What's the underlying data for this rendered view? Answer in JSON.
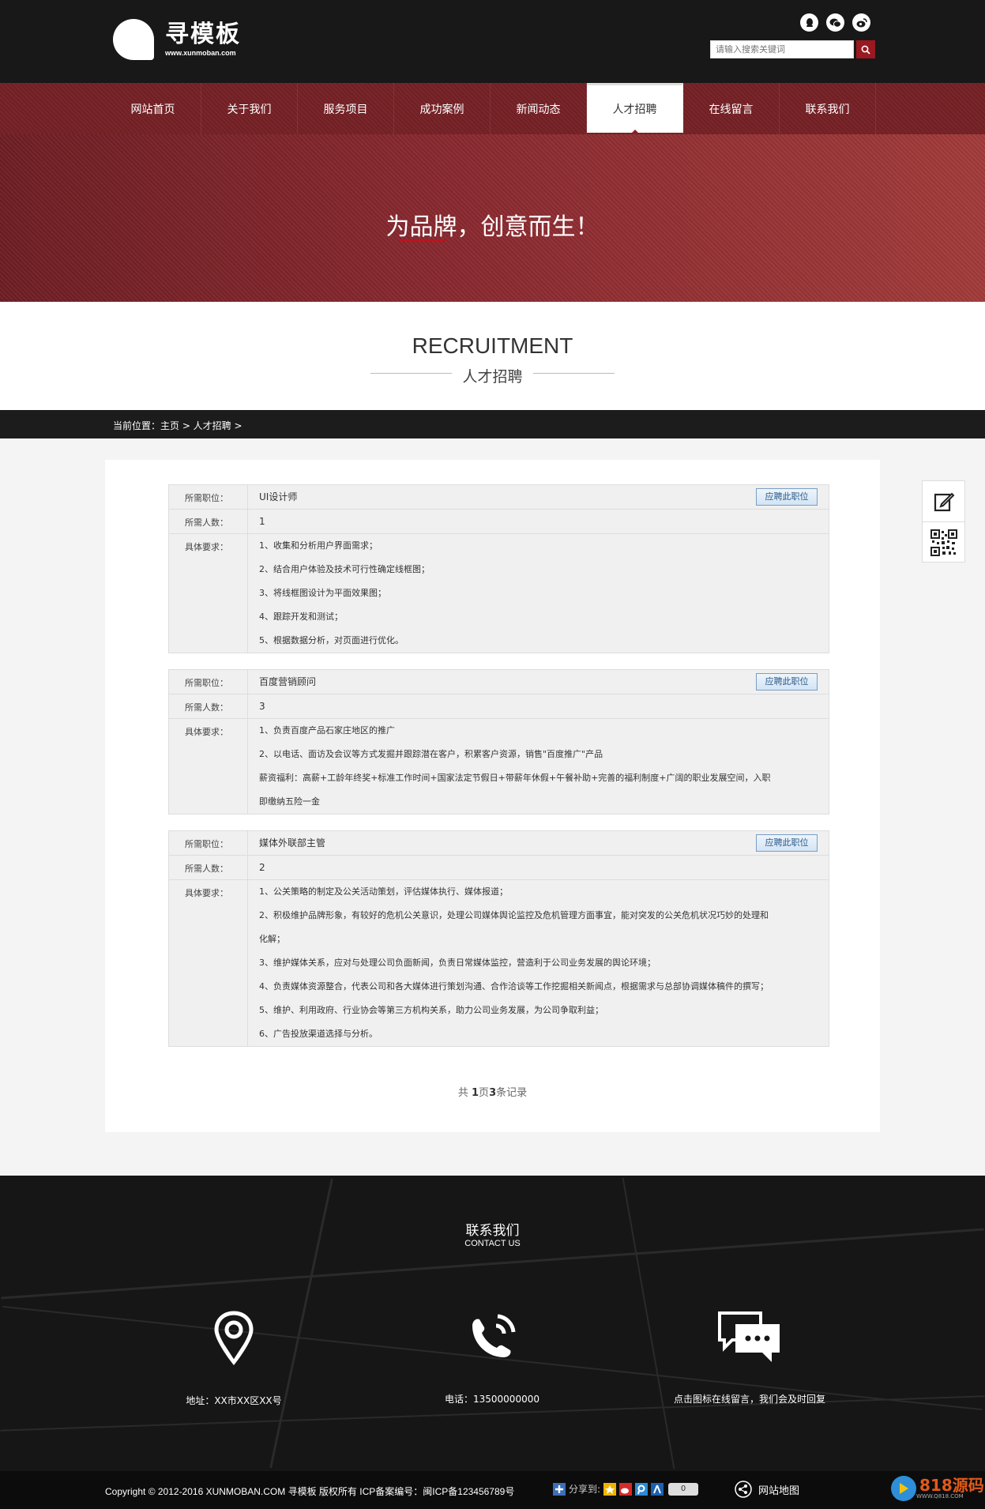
{
  "header": {
    "logo_title": "寻模板",
    "logo_domain": "www.xunmoban.com",
    "search_placeholder": "请输入搜索关键词",
    "social_icons": [
      "qq-icon",
      "wechat-icon",
      "weibo-icon"
    ]
  },
  "nav": {
    "items": [
      "网站首页",
      "关于我们",
      "服务项目",
      "成功案例",
      "新闻动态",
      "人才招聘",
      "在线留言",
      "联系我们"
    ],
    "active_index": 5
  },
  "banner": {
    "slogan": "为品牌，创意而生！"
  },
  "section_title": {
    "en": "RECRUITMENT",
    "cn": "人才招聘"
  },
  "breadcrumb": {
    "text": "当前位置：主页 > 人才招聘 >"
  },
  "labels": {
    "position": "所需职位：",
    "count": "所需人数：",
    "requirements": "具体要求：",
    "apply": "应聘此职位"
  },
  "jobs": [
    {
      "position": "UI设计师",
      "count": "1",
      "requirements": [
        "1、收集和分析用户界面需求；",
        "2、结合用户体验及技术可行性确定线框图；",
        "3、将线框图设计为平面效果图；",
        "4、跟踪开发和测试；",
        "5、根据数据分析，对页面进行优化。"
      ]
    },
    {
      "position": "百度营销顾问",
      "count": "3",
      "requirements": [
        "1、负责百度产品石家庄地区的推广",
        "2、以电话、面访及会议等方式发掘并跟踪潜在客户，积累客户资源，销售\"百度推广\"产品",
        "薪资福利：高薪+工龄年终奖+标准工作时间+国家法定节假日+带薪年休假+午餐补助+完善的福利制度+广阔的职业发展空间，入职",
        "即缴纳五险一金"
      ]
    },
    {
      "position": "媒体外联部主管",
      "count": "2",
      "requirements": [
        "1、公关策略的制定及公关活动策划，评估媒体执行、媒体报道；",
        "2、积极维护品牌形象，有较好的危机公关意识，处理公司媒体舆论监控及危机管理方面事宜，能对突发的公关危机状况巧妙的处理和",
        "化解；",
        "3、维护媒体关系，应对与处理公司负面新闻，负责日常媒体监控，营造利于公司业务发展的舆论环境；",
        "4、负责媒体资源整合，代表公司和各大媒体进行策划沟通、合作洽谈等工作挖掘相关新闻点，根据需求与总部协调媒体稿件的撰写；",
        "5、维护、利用政府、行业协会等第三方机构关系，助力公司业务发展，为公司争取利益；",
        "6、广告投放渠道选择与分析。"
      ]
    }
  ],
  "pager": {
    "prefix": "共 ",
    "pages": "1",
    "mid": "页",
    "records": "3",
    "suffix": "条记录"
  },
  "footer": {
    "title": "联系我们",
    "subtitle": "CONTACT US",
    "address": "地址：XX市XX区XX号",
    "phone": "电话：13500000000",
    "message": "点击图标在线留言，我们会及时回复"
  },
  "copyright": {
    "text": "Copyright © 2012-2016 XUNMOBAN.COM 寻模板 版权所有  ICP备案编号：闽ICP备123456789号",
    "share_label": "分享到:",
    "share_count": "0",
    "sitemap": "网站地图",
    "brand_name": "818源码",
    "brand_url": "WWW.Q818.COM"
  }
}
